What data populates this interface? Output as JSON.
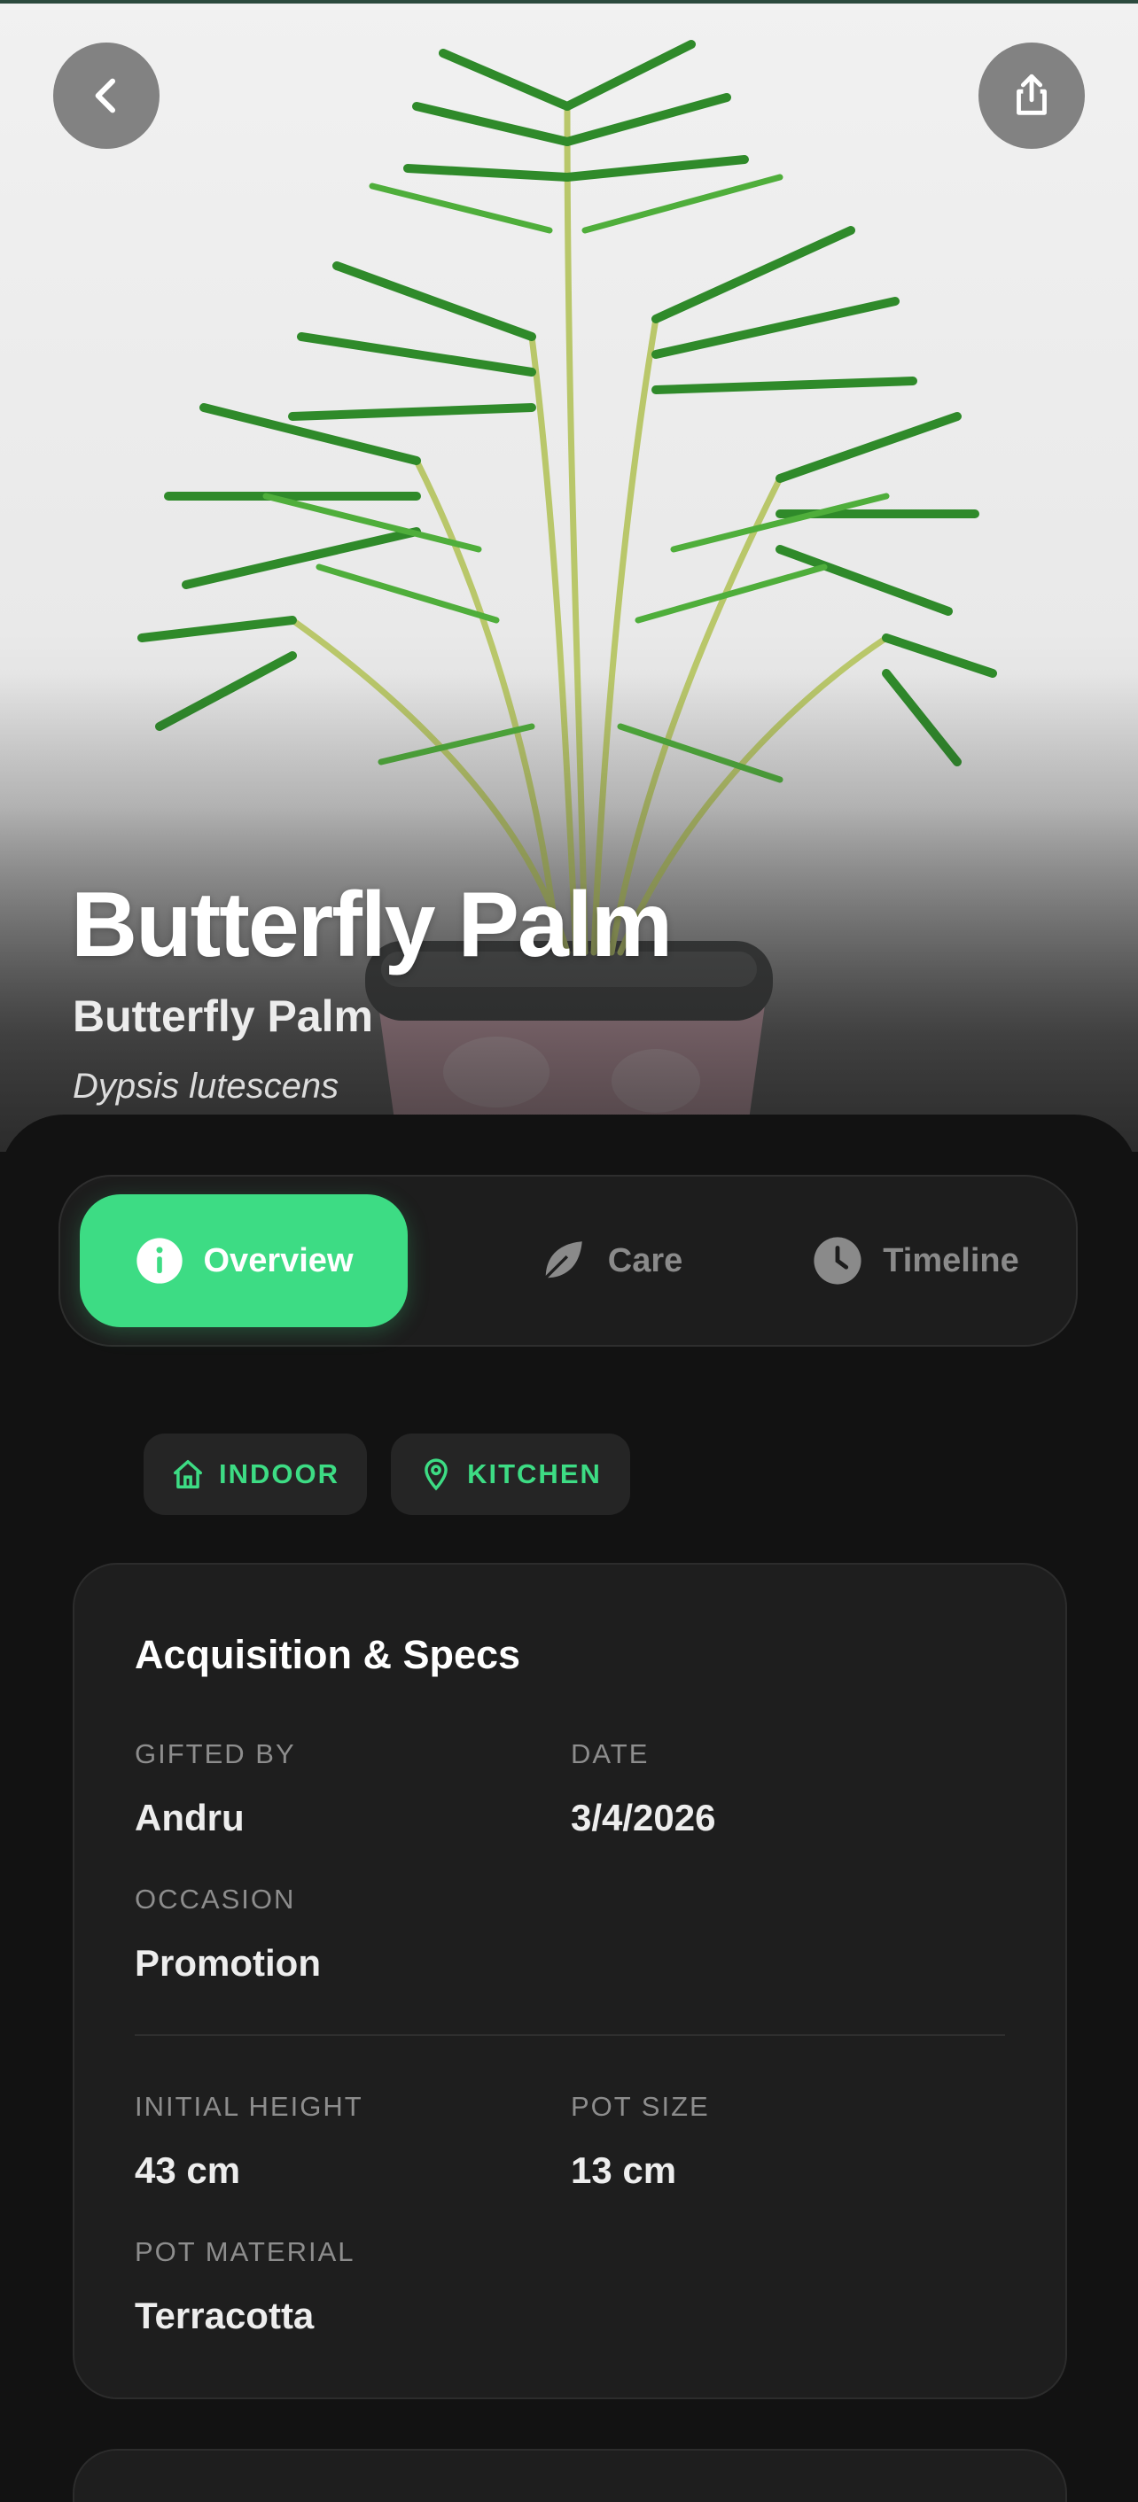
{
  "header": {
    "back_icon": "chevron-left-icon",
    "share_icon": "share-icon"
  },
  "plant": {
    "name": "Butterfly Palm",
    "common_name": "Butterfly Palm",
    "scientific_name": "Dypsis lutescens"
  },
  "tabs": [
    {
      "label": "Overview",
      "icon": "info-icon",
      "active": true
    },
    {
      "label": "Care",
      "icon": "leaf-icon",
      "active": false
    },
    {
      "label": "Timeline",
      "icon": "clock-icon",
      "active": false
    }
  ],
  "tags": [
    {
      "label": "INDOOR",
      "icon": "home-icon"
    },
    {
      "label": "KITCHEN",
      "icon": "map-pin-icon"
    }
  ],
  "acquisition": {
    "title": "Acquisition & Specs",
    "gifted_by": {
      "label": "GIFTED BY",
      "value": "Andru"
    },
    "date": {
      "label": "DATE",
      "value": "3/4/2026"
    },
    "occasion": {
      "label": "OCCASION",
      "value": "Promotion"
    },
    "initial_height": {
      "label": "INITIAL HEIGHT",
      "value": "43 cm"
    },
    "pot_size": {
      "label": "POT SIZE",
      "value": "13 cm"
    },
    "pot_material": {
      "label": "POT MATERIAL",
      "value": "Terracotta"
    }
  },
  "colors": {
    "accent": "#3ddc84",
    "background": "#121212",
    "card": "#1e1e1e"
  }
}
